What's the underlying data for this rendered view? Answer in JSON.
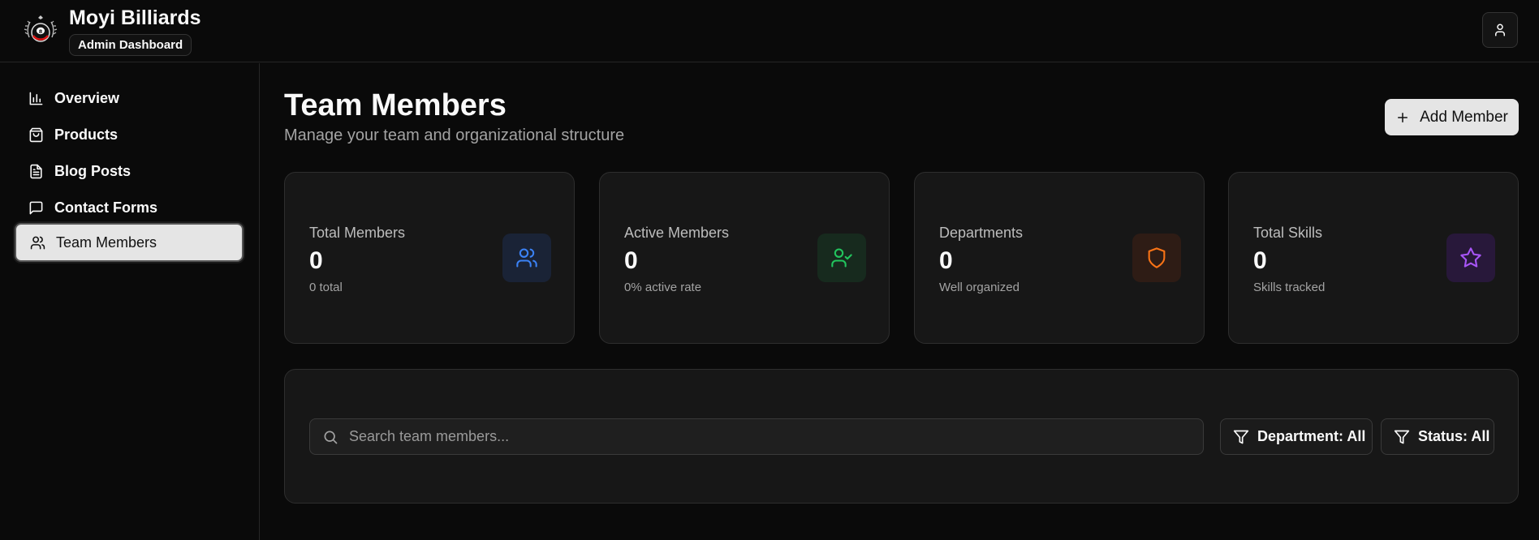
{
  "header": {
    "brand_name": "Moyi Billiards",
    "brand_badge": "Admin Dashboard"
  },
  "sidebar": {
    "items": [
      {
        "label": "Overview",
        "icon": "bar-chart-icon"
      },
      {
        "label": "Products",
        "icon": "shopping-bag-icon"
      },
      {
        "label": "Blog Posts",
        "icon": "file-text-icon"
      },
      {
        "label": "Contact Forms",
        "icon": "message-square-icon"
      },
      {
        "label": "Team Members",
        "icon": "users-icon",
        "active": true
      }
    ]
  },
  "main": {
    "title": "Team Members",
    "subtitle": "Manage your team and organizational structure",
    "add_button_label": "Add Member",
    "stats": [
      {
        "label": "Total Members",
        "value": "0",
        "note": "0 total",
        "icon": "users-icon",
        "color": "#3b82f6"
      },
      {
        "label": "Active Members",
        "value": "0",
        "note": "0% active rate",
        "icon": "user-check-icon",
        "color": "#22c55e"
      },
      {
        "label": "Departments",
        "value": "0",
        "note": "Well organized",
        "icon": "shield-icon",
        "color": "#f97316"
      },
      {
        "label": "Total Skills",
        "value": "0",
        "note": "Skills tracked",
        "icon": "star-icon",
        "color": "#a855f7"
      }
    ],
    "search": {
      "placeholder": "Search team members...",
      "value": ""
    },
    "filters": {
      "department_label": "Department: All",
      "status_label": "Status: All"
    }
  }
}
